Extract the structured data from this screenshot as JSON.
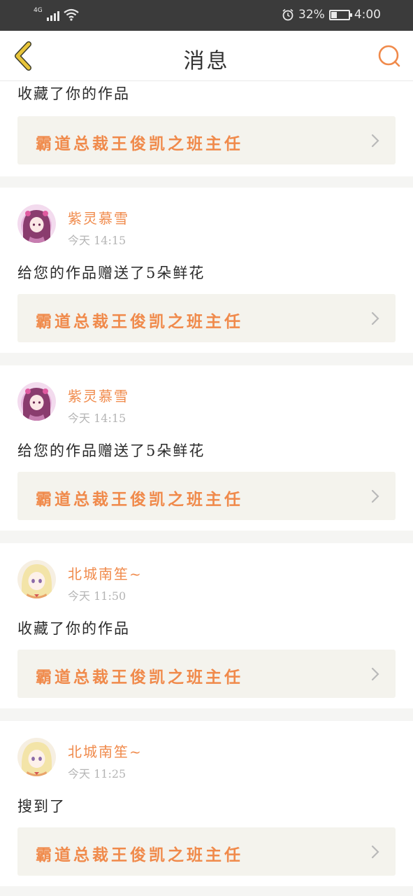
{
  "status_bar": {
    "network": "4G",
    "battery_percent_label": "32%",
    "battery_level": 0.32,
    "time": "4:00",
    "icons": [
      "signal-icon",
      "wifi-icon",
      "alarm-icon",
      "battery-icon"
    ]
  },
  "header": {
    "title": "消息",
    "back_icon": "chevron-left-icon",
    "search_icon": "search-icon"
  },
  "colors": {
    "accent": "#f08a4b",
    "back_arrow": "#e8c53a",
    "status_bar": "#3b3b3b",
    "card_link_bg": "#f4f3ed"
  },
  "messages": [
    {
      "text": "收藏了你的作品",
      "work_title": "霸道总裁王俊凯之班主任"
    },
    {
      "user": "紫灵慕雪",
      "time": "今天 14:15",
      "text": "给您的作品赠送了5朵鲜花",
      "work_title": "霸道总裁王俊凯之班主任"
    },
    {
      "user": "紫灵慕雪",
      "time": "今天 14:15",
      "text": "给您的作品赠送了5朵鲜花",
      "work_title": "霸道总裁王俊凯之班主任"
    },
    {
      "user": "北城南笙~",
      "time": "今天 11:50",
      "text": "收藏了你的作品",
      "work_title": "霸道总裁王俊凯之班主任"
    },
    {
      "user": "北城南笙~",
      "time": "今天 11:25",
      "text": "搜到了",
      "work_title": "霸道总裁王俊凯之班主任"
    }
  ]
}
